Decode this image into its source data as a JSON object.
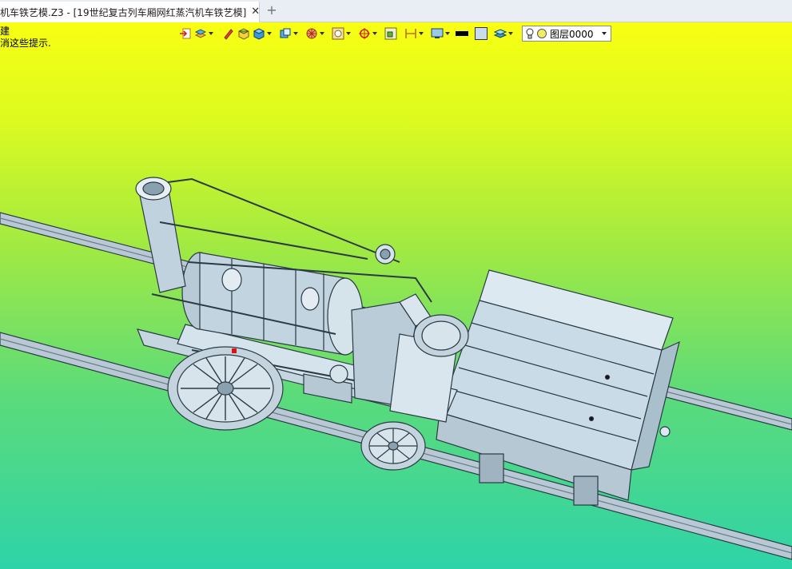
{
  "tab": {
    "title": "机车铁艺模.Z3 - [19世纪复古列车厢网红蒸汽机车铁艺模]",
    "close_glyph": "✕",
    "new_tab_glyph": "+"
  },
  "hint": {
    "line1": "建",
    "line2": "消这些提示."
  },
  "toolbar": {
    "buttons": [
      {
        "name": "exit-sketch-icon",
        "has_dropdown": false
      },
      {
        "name": "layers-stack-icon",
        "has_dropdown": true
      },
      {
        "name": "pencil-icon",
        "has_dropdown": false
      },
      {
        "name": "shaded-box-icon",
        "has_dropdown": false
      },
      {
        "name": "cube-icon",
        "has_dropdown": true
      },
      {
        "name": "view-cube-icon",
        "has_dropdown": true
      },
      {
        "name": "gear-render-icon",
        "has_dropdown": true
      },
      {
        "name": "frame-icon",
        "has_dropdown": true
      },
      {
        "name": "snap-target-icon",
        "has_dropdown": true
      },
      {
        "name": "zoom-box-icon",
        "has_dropdown": false
      },
      {
        "name": "dimension-icon",
        "has_dropdown": true
      },
      {
        "name": "display-monitor-icon",
        "has_dropdown": true
      },
      {
        "name": "line-color-swatch",
        "has_dropdown": false
      },
      {
        "name": "fill-color-swatch",
        "has_dropdown": false
      },
      {
        "name": "layer-manager-icon",
        "has_dropdown": true
      }
    ],
    "layer_value": "图层0000"
  },
  "colors": {
    "bg_top": "#f8ff12",
    "bg_bottom": "#2ed3a8",
    "model_fill": "#cfe0ea",
    "model_line": "#2b3a44"
  }
}
